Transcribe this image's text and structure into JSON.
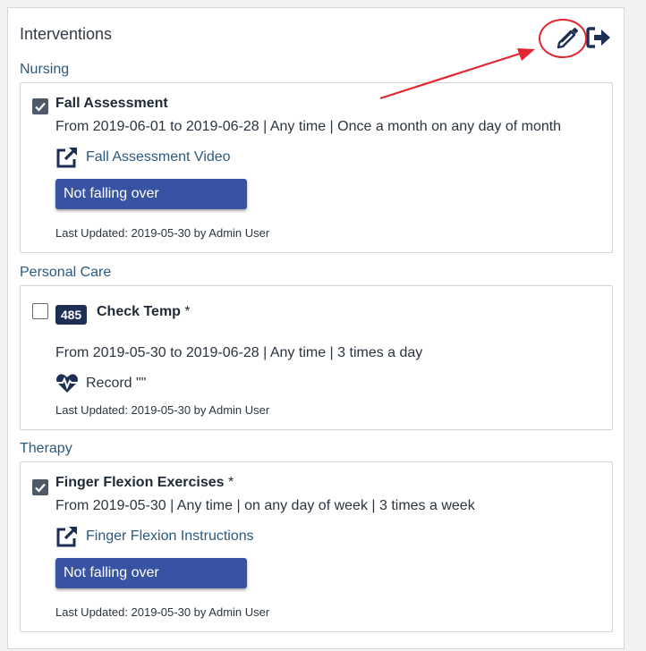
{
  "panel": {
    "title": "Interventions",
    "edit_icon": "pencil-icon",
    "exit_icon": "sign-out-icon"
  },
  "sections": [
    {
      "label": "Nursing",
      "item": {
        "checked": true,
        "title": "Fall Assessment",
        "schedule": "From 2019-06-01 to 2019-06-28 | Any time | Once a month on any day of month",
        "link_label": "Fall Assessment Video",
        "link_icon": "external-link-icon",
        "goal_label": "Not falling over",
        "last_updated": "Last Updated: 2019-05-30 by Admin User"
      }
    },
    {
      "label": "Personal Care",
      "item": {
        "checked": false,
        "badge": "485",
        "title": "Check Temp",
        "required_mark": "*",
        "schedule": "From 2019-05-30 to 2019-06-28 | Any time | 3 times a day",
        "record_label": "Record \"\"",
        "record_icon": "heartbeat-icon",
        "last_updated": "Last Updated: 2019-05-30 by Admin User"
      }
    },
    {
      "label": "Therapy",
      "item": {
        "checked": true,
        "title": "Finger Flexion Exercises",
        "required_mark": "*",
        "schedule": "From 2019-05-30 | Any time | on any day of week | 3 times a week",
        "link_label": "Finger Flexion Instructions",
        "link_icon": "external-link-icon",
        "goal_label": "Not falling over",
        "last_updated": "Last Updated: 2019-05-30 by Admin User"
      }
    }
  ],
  "colors": {
    "accent": "#3852a4",
    "link": "#2c5a7f",
    "annotation": "#e0262e",
    "icon": "#1e2f55"
  }
}
